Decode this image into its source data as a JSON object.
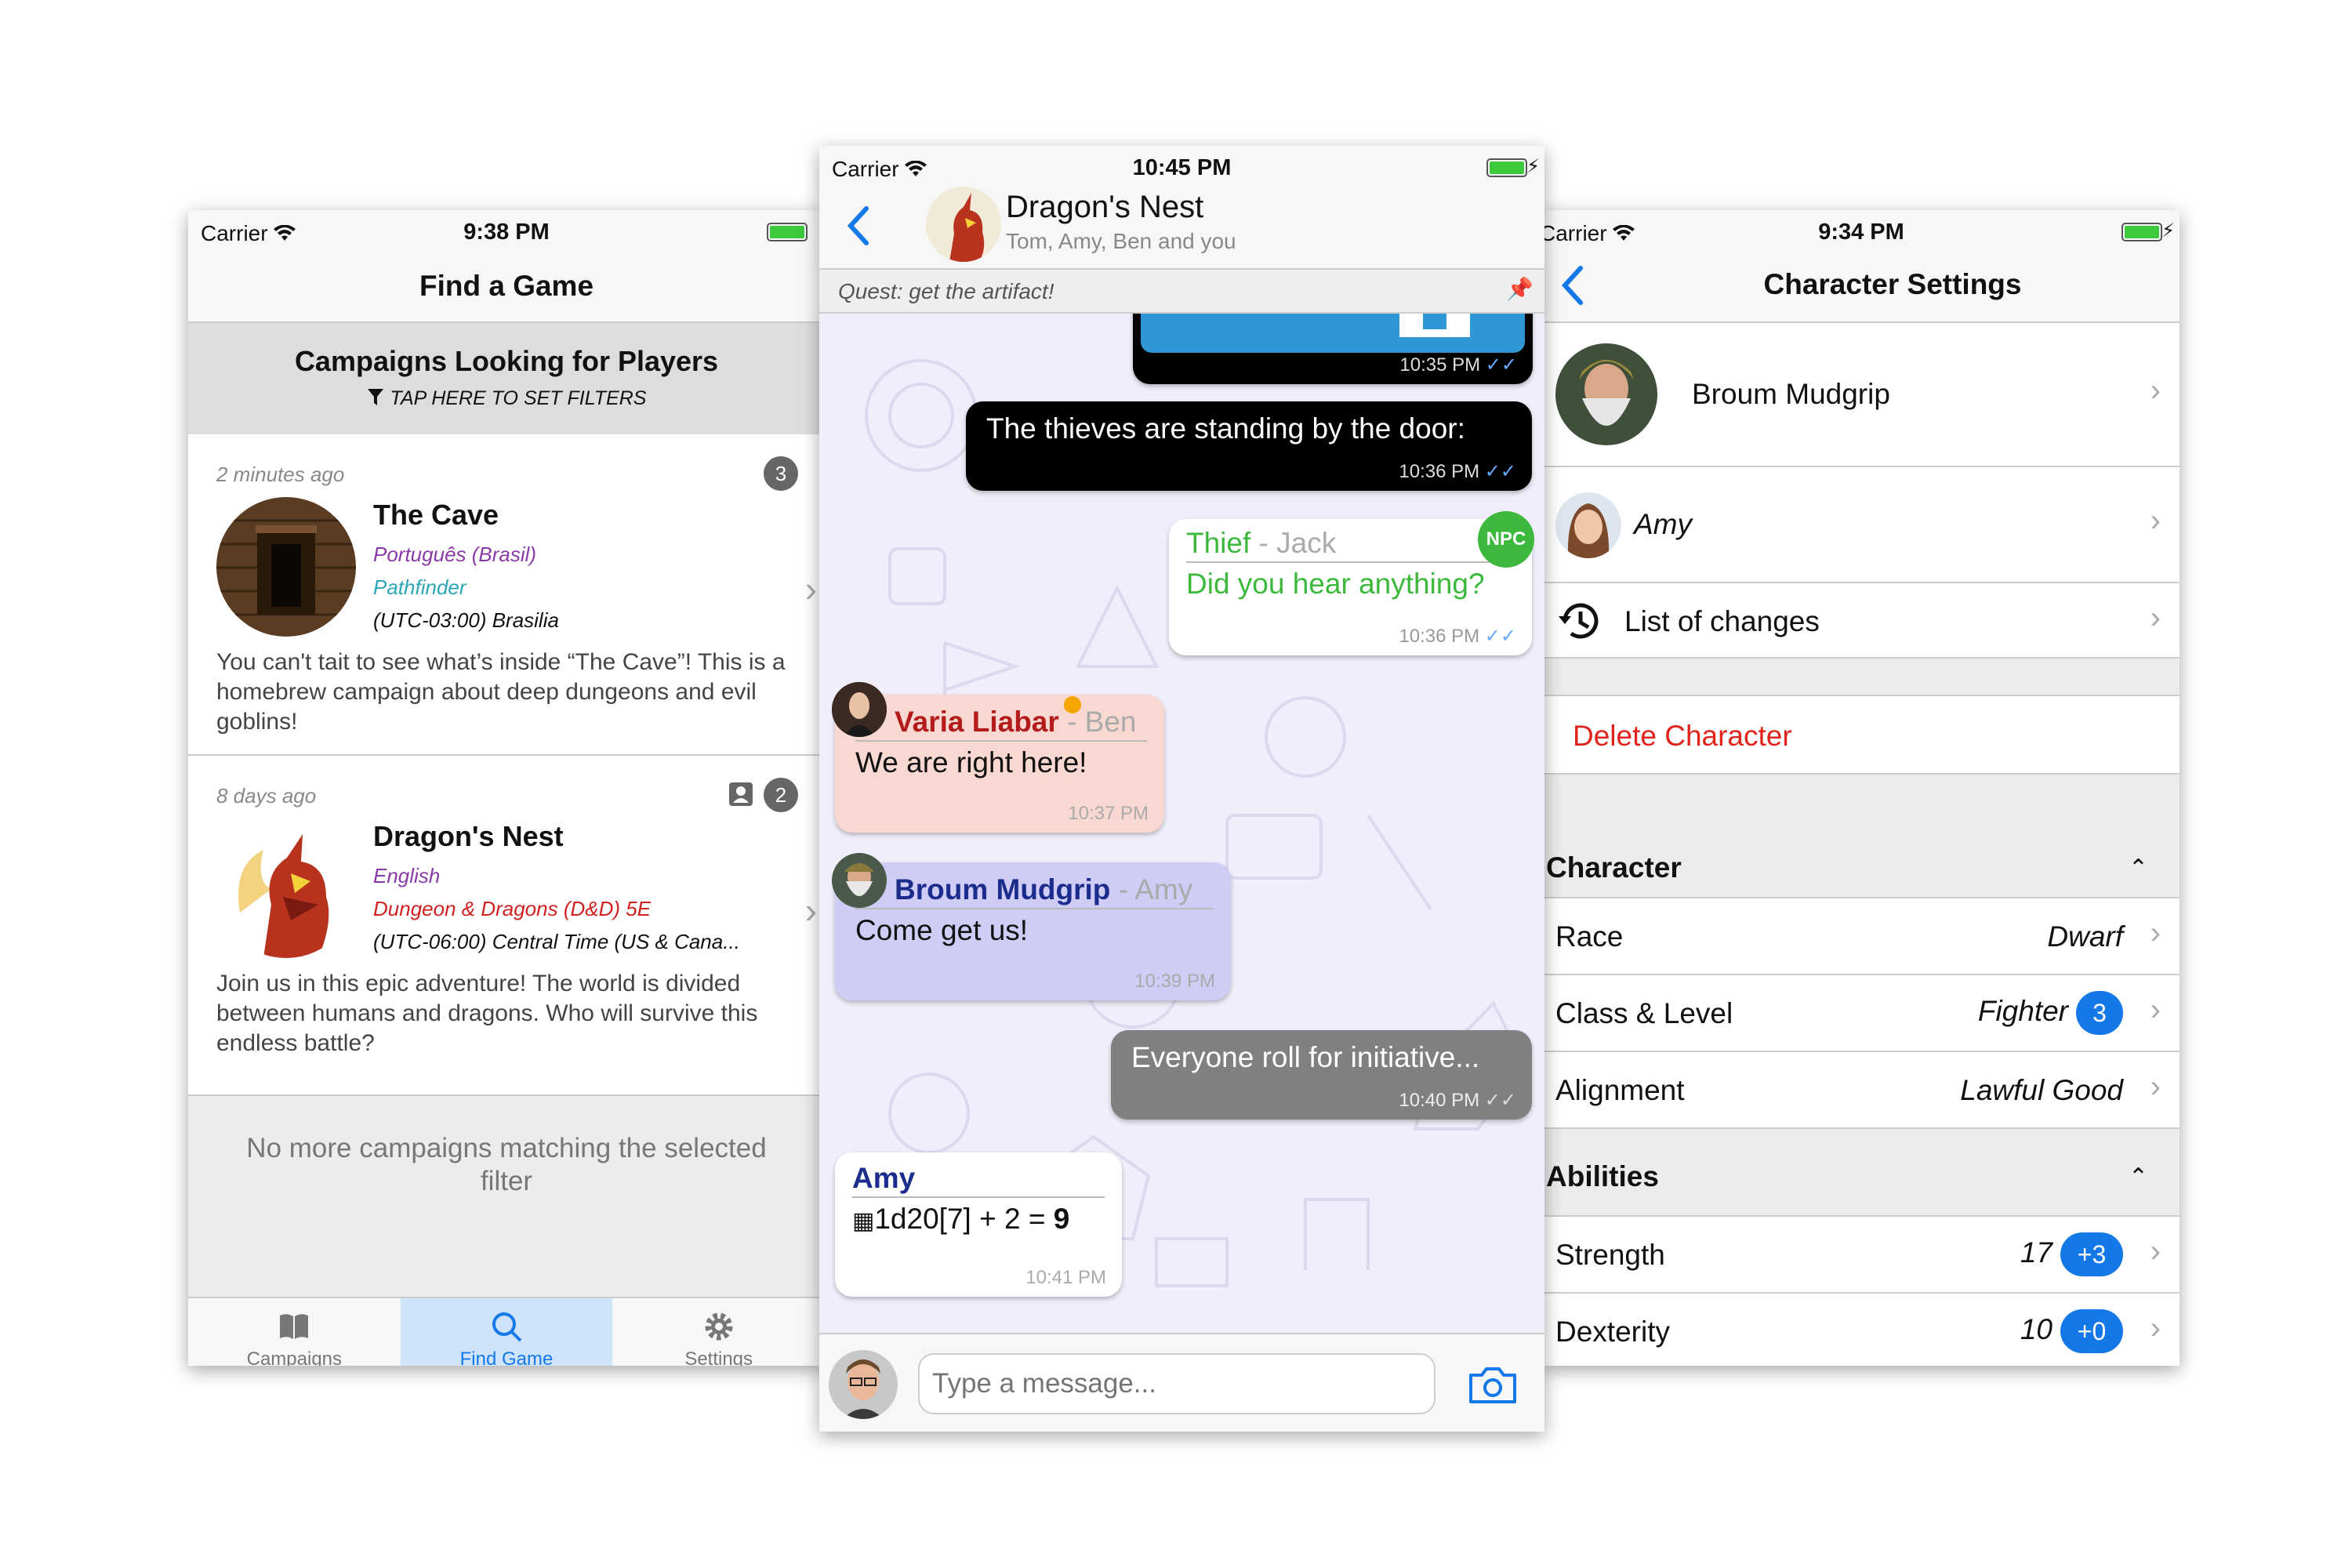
{
  "find_game": {
    "status": {
      "carrier": "Carrier",
      "time": "9:38 PM"
    },
    "title": "Find a Game",
    "section_title": "Campaigns Looking for Players",
    "filter_text": "TAP HERE TO SET FILTERS",
    "cards": [
      {
        "ago": "2 minutes ago",
        "badge": "3",
        "name": "The Cave",
        "language": "Português (Brasil)",
        "system": "Pathfinder",
        "system_color": "#2aa6b4",
        "timezone": "(UTC-03:00) Brasilia",
        "description": "You can't tait to see what’s inside “The Cave”! This is a homebrew campaign about deep dungeons and evil goblins!"
      },
      {
        "ago": "8 days ago",
        "badge": "2",
        "name": "Dragon's Nest",
        "language": "English",
        "system": "Dungeon & Dragons (D&D) 5E",
        "system_color": "#d02020",
        "timezone": "(UTC-06:00) Central Time (US & Cana...",
        "description": "Join us in this epic adventure! The world is divided between humans and dragons. Who will survive this endless battle?"
      }
    ],
    "no_more": "No more campaigns matching the selected filter",
    "tabs": {
      "campaigns": "Campaigns",
      "find_game": "Find Game",
      "settings": "Settings"
    }
  },
  "chat": {
    "status": {
      "carrier": "Carrier",
      "time": "10:45 PM"
    },
    "title": "Dragon's Nest",
    "subtitle": "Tom, Amy, Ben and you",
    "quest": "Quest: get the artifact!",
    "messages": {
      "m0_time": "10:35 PM",
      "m1_text": "The thieves are standing by the door:",
      "m1_time": "10:36 PM",
      "m2_name": "Thief",
      "m2_player": "- Jack",
      "m2_badge": "NPC",
      "m2_text": "Did you hear anything?",
      "m2_time": "10:36 PM",
      "m3_name": "Varia Liabar",
      "m3_player": "- Ben",
      "m3_text": "We are right here!",
      "m3_time": "10:37 PM",
      "m4_name": "Broum Mudgrip",
      "m4_player": "- Amy",
      "m4_text": "Come get us!",
      "m4_time": "10:39 PM",
      "m5_text": "Everyone roll for initiative...",
      "m5_time": "10:40 PM",
      "m6_name": "Amy",
      "m6_roll": "1d20[7] + 2 = ",
      "m6_result": "9",
      "m6_time": "10:41 PM"
    },
    "placeholder": "Type a message..."
  },
  "character": {
    "status": {
      "carrier": "Carrier",
      "time": "9:34 PM"
    },
    "title": "Character Settings",
    "name": "Broum Mudgrip",
    "player": "Amy",
    "history": "List of changes",
    "delete": "Delete Character",
    "sections": {
      "character": "Character",
      "abilities": "Abilities"
    },
    "race_label": "Race",
    "race_value": "Dwarf",
    "class_label": "Class & Level",
    "class_value": "Fighter",
    "level": "3",
    "alignment_label": "Alignment",
    "alignment_value": "Lawful Good",
    "str_label": "Strength",
    "str_value": "17",
    "str_mod": "+3",
    "dex_label": "Dexterity",
    "dex_value": "10",
    "dex_mod": "+0"
  },
  "colors": {
    "accent": "#1478e8",
    "delete": "#e0241c",
    "npc": "#3cb83c",
    "varia": "#b41c1c",
    "broum": "#1c2c8c"
  }
}
